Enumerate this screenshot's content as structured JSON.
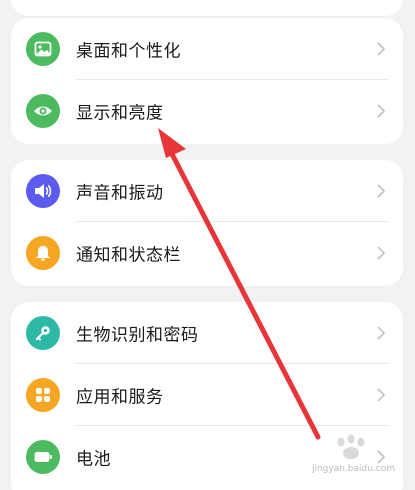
{
  "settings": {
    "sections": [
      {
        "items": [
          {
            "label": "桌面和个性化",
            "icon": "image-icon",
            "color": "#4cbb5f"
          },
          {
            "label": "显示和亮度",
            "icon": "eye-icon",
            "color": "#4cbb5f"
          }
        ]
      },
      {
        "items": [
          {
            "label": "声音和振动",
            "icon": "speaker-icon",
            "color": "#5b5bf0"
          },
          {
            "label": "通知和状态栏",
            "icon": "bell-icon",
            "color": "#f5a623"
          }
        ]
      },
      {
        "items": [
          {
            "label": "生物识别和密码",
            "icon": "key-icon",
            "color": "#2db9a6"
          },
          {
            "label": "应用和服务",
            "icon": "apps-grid-icon",
            "color": "#f5a623"
          },
          {
            "label": "电池",
            "icon": "battery-icon",
            "color": "#4cbb5f"
          }
        ]
      }
    ]
  },
  "watermark": {
    "site": "jingyan.baidu.com"
  },
  "annotation": {
    "color": "#e8353a"
  }
}
